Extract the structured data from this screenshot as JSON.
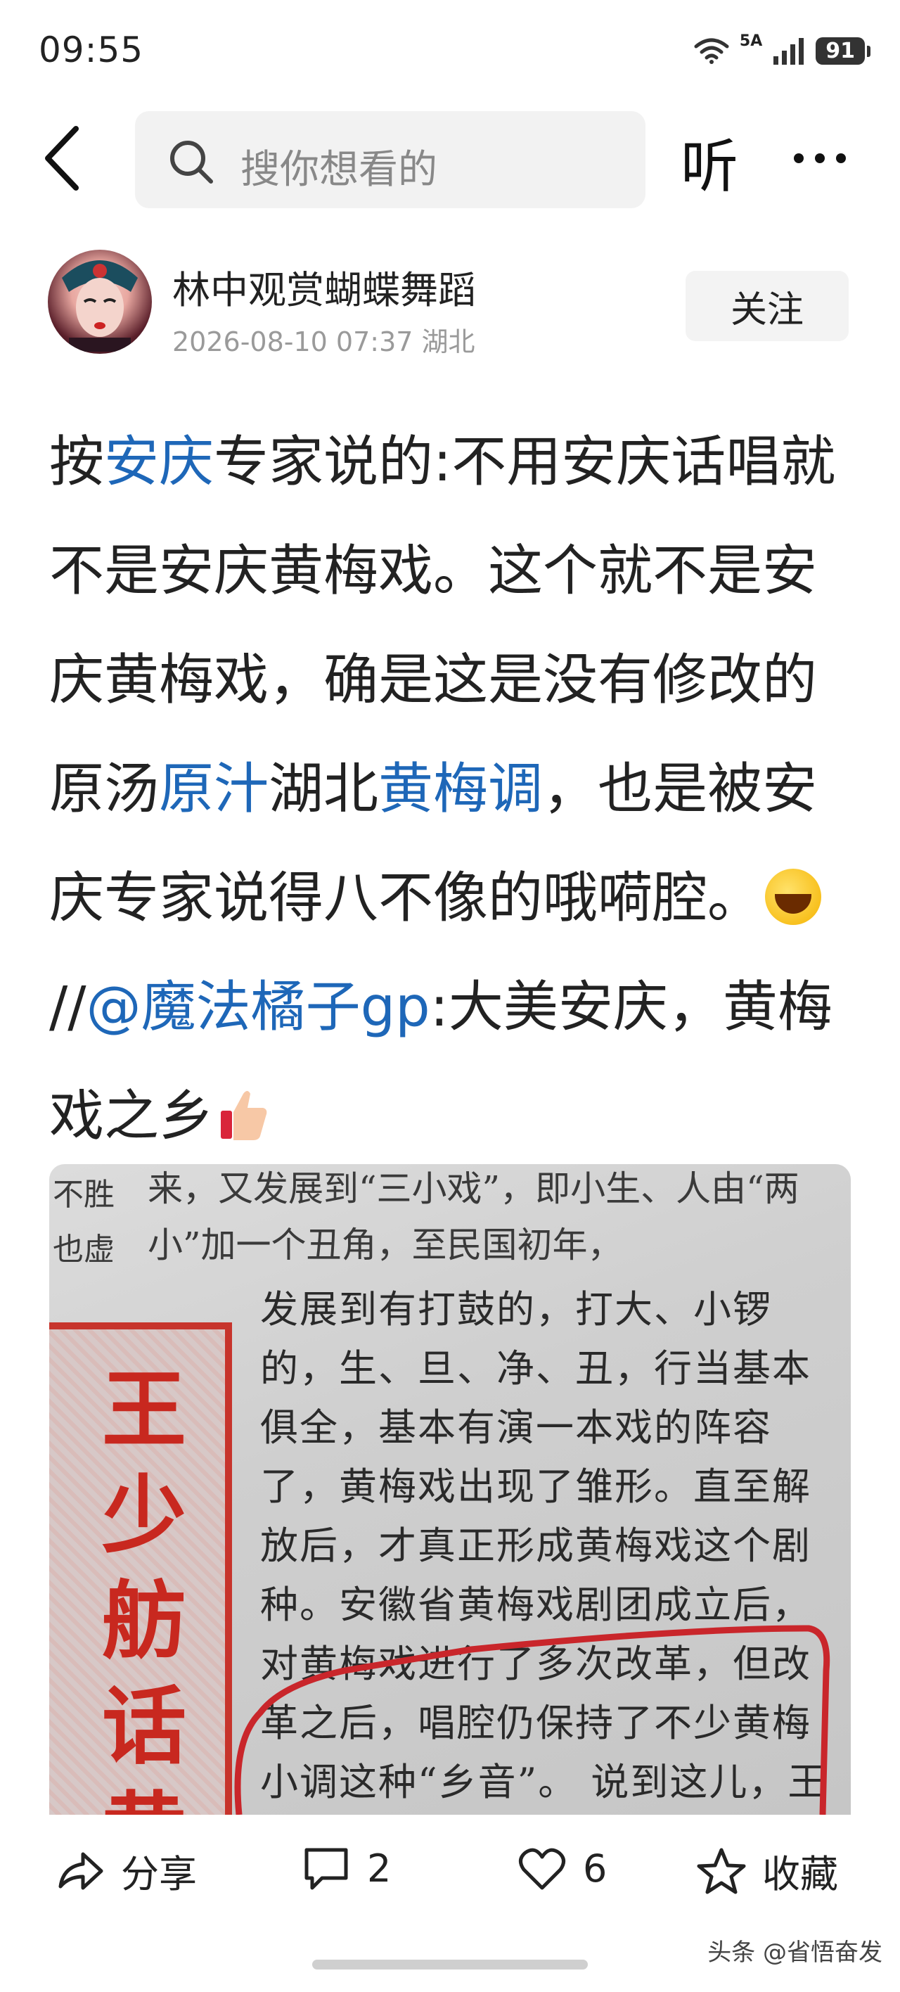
{
  "status": {
    "time": "09:55",
    "network": "5A",
    "battery": "91",
    "icons": [
      "wifi-icon",
      "signal-icon",
      "battery-icon"
    ]
  },
  "header": {
    "search_placeholder": "搜你想看的",
    "listen_label": "听",
    "icons": [
      "back-icon",
      "search-icon",
      "more-icon"
    ]
  },
  "post": {
    "author": "林中观赏蝴蝶舞蹈",
    "timestamp": "2026-08-10 07:37",
    "location": "湖北",
    "follow_label": "关注",
    "content": {
      "s1": "按",
      "s2": "安庆",
      "s3": "专家说的:不用安庆话唱就不是安庆黄梅戏。这个就不是安庆黄梅戏，确是这是没有修改的原汤",
      "s4": "原汁",
      "s5": "湖北",
      "s6": "黄梅调",
      "s7": "，也是被安庆专家说得八不像的哦嗬腔。",
      "s8": "//",
      "s9": "@魔法橘子gp",
      "s10": ":大美安庆，黄梅戏之乡"
    },
    "link_color": "#1e67b8"
  },
  "image": {
    "headline": "王少舫话黄梅",
    "top_text": "来，又发展到“三小戏”，即小生、人由“两小”加一个丑角，至民国初年，",
    "left_text": "不胜 也虚",
    "body_text": "发展到有打鼓的，打大、小锣的，生、旦、净、丑，行当基本俱全，基本有演一本戏的阵容了，黄梅戏出现了雏形。直至解放后，才真正形成黄梅戏这个剧种。安徽省黄梅戏剧团成立后，对黄梅戏进行了多次改革，但改革之后，唱腔仍保持了不少黄梅小调这种“乡音”。 说到这儿，王少舫从椅子上站起来，做起手势，带着表情唱起来：“龙归大海，鸟入林……” 唱完之后，他接着解释："
  },
  "actions": {
    "share_label": "分享",
    "comment_count": "2",
    "like_count": "6",
    "collect_label": "收藏"
  },
  "watermark": "头条 @省悟奋发"
}
